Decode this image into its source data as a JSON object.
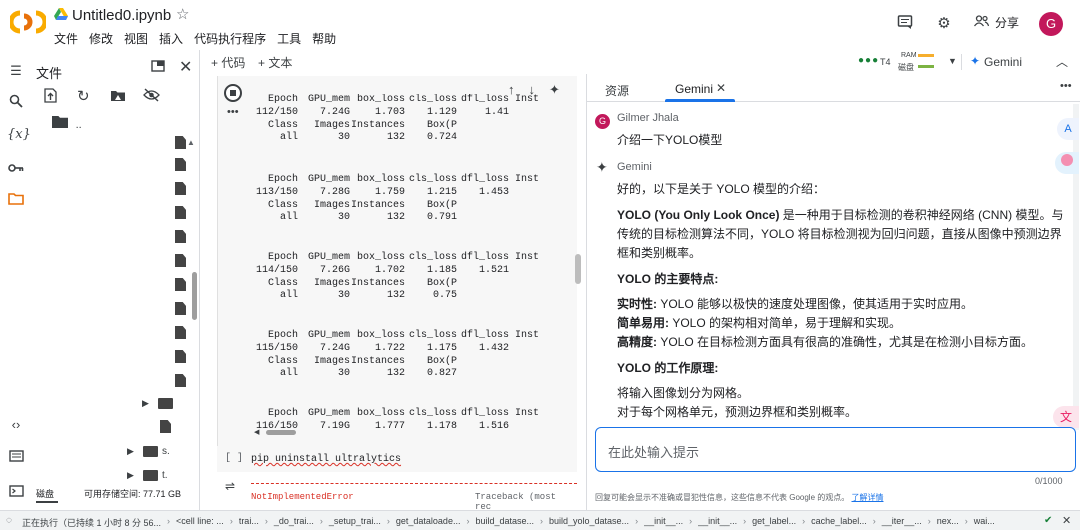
{
  "header": {
    "title": "Untitled0.ipynb",
    "menu": [
      "文件",
      "修改",
      "视图",
      "插入",
      "代码执行程序",
      "工具",
      "帮助"
    ],
    "share_label": "分享",
    "avatar_letter": "G"
  },
  "files_panel": {
    "title": "文件",
    "parent_dir": "..",
    "folder_s_label": "s.",
    "folder_t_label": "t.",
    "disk_label": "磁盘",
    "disk_free": "可用存储空间: 77.71 GB"
  },
  "notebook": {
    "add_code": "+ 代码",
    "add_text": "+ 文本",
    "runtime": "T4",
    "ram_label": "RAM",
    "disk_label": "磁盘",
    "epochs": [
      {
        "header": [
          "Epoch",
          "GPU_mem",
          "box_loss",
          "cls_loss",
          "dfl_loss",
          "Inst"
        ],
        "values": [
          "112/150",
          "7.24G",
          "1.703",
          "1.129",
          "1.41",
          ""
        ],
        "h2": [
          "Class",
          "Images",
          "Instances",
          "Box(P"
        ],
        "v2": [
          "all",
          "30",
          "132",
          "0.724"
        ]
      },
      {
        "header": [
          "Epoch",
          "GPU_mem",
          "box_loss",
          "cls_loss",
          "dfl_loss",
          "Inst"
        ],
        "values": [
          "113/150",
          "7.28G",
          "1.759",
          "1.215",
          "1.453",
          ""
        ],
        "h2": [
          "Class",
          "Images",
          "Instances",
          "Box(P"
        ],
        "v2": [
          "all",
          "30",
          "132",
          "0.791"
        ]
      },
      {
        "header": [
          "Epoch",
          "GPU_mem",
          "box_loss",
          "cls_loss",
          "dfl_loss",
          "Inst"
        ],
        "values": [
          "114/150",
          "7.26G",
          "1.702",
          "1.185",
          "1.521",
          ""
        ],
        "h2": [
          "Class",
          "Images",
          "Instances",
          "Box(P"
        ],
        "v2": [
          "all",
          "30",
          "132",
          "0.75"
        ]
      },
      {
        "header": [
          "Epoch",
          "GPU_mem",
          "box_loss",
          "cls_loss",
          "dfl_loss",
          "Inst"
        ],
        "values": [
          "115/150",
          "7.24G",
          "1.722",
          "1.175",
          "1.432",
          ""
        ],
        "h2": [
          "Class",
          "Images",
          "Instances",
          "Box(P"
        ],
        "v2": [
          "all",
          "30",
          "132",
          "0.827"
        ]
      },
      {
        "header": [
          "Epoch",
          "GPU_mem",
          "box_loss",
          "cls_loss",
          "dfl_loss",
          "Inst"
        ],
        "values": [
          "116/150",
          "7.19G",
          "1.777",
          "1.178",
          "1.516",
          ""
        ]
      }
    ],
    "cell2_bracket": "[ ]",
    "cell2_code": "pip  uninstall  ultralytics",
    "cell3_error": "NotImplementedError",
    "cell3_tb": "Traceback (most rec"
  },
  "gemini_panel": {
    "tab_resources": "资源",
    "tab_gemini": "Gemini",
    "gemini_button": "Gemini",
    "user_name": "Gilmer Jhala",
    "user_avatar": "G",
    "user_message": "介绍一下YOLO模型",
    "bot_name": "Gemini",
    "intro": "好的，以下是关于 YOLO 模型的介绍：",
    "p1_bold": "YOLO (You Only Look Once)",
    "p1_text": " 是一种用于目标检测的卷积神经网络 (CNN) 模型。与传统的目标检测算法不同，YOLO 将目标检测视为回归问题，直接从图像中预测边界框和类别概率。",
    "features_title": "YOLO 的主要特点:",
    "f1_bold": "实时性:",
    "f1_text": " YOLO 能够以极快的速度处理图像，使其适用于实时应用。",
    "f2_bold": "简单易用:",
    "f2_text": " YOLO 的架构相对简单，易于理解和实现。",
    "f3_bold": "高精度:",
    "f3_text": " YOLO 在目标检测方面具有很高的准确性，尤其是在检测小目标方面。",
    "work_title": "YOLO 的工作原理:",
    "w1": "将输入图像划分为网格。",
    "w2": "对于每个网格单元，预测边界框和类别概率。",
    "input_placeholder": "在此处输入提示",
    "counter": "0/1000",
    "disclaimer": "回复可能会显示不准确或冒犯性信息，这些信息不代表 Google 的观点。",
    "disclaimer_link": "了解详情"
  },
  "status_bar": {
    "items": [
      "正在执行（已持续 1 小时 8 分 56...",
      "<cell line: ...",
      "trai...",
      "_do_trai...",
      "_setup_trai...",
      "get_dataloade...",
      "build_datase...",
      "build_yolo_datase...",
      "__init__...",
      "__init__...",
      "get_label...",
      "cache_label...",
      "__iter__...",
      "nex...",
      "wai..."
    ]
  },
  "colors": {
    "accent": "#1a73e8",
    "colab_orange": "#f9ab00",
    "avatar": "#c2185b"
  }
}
